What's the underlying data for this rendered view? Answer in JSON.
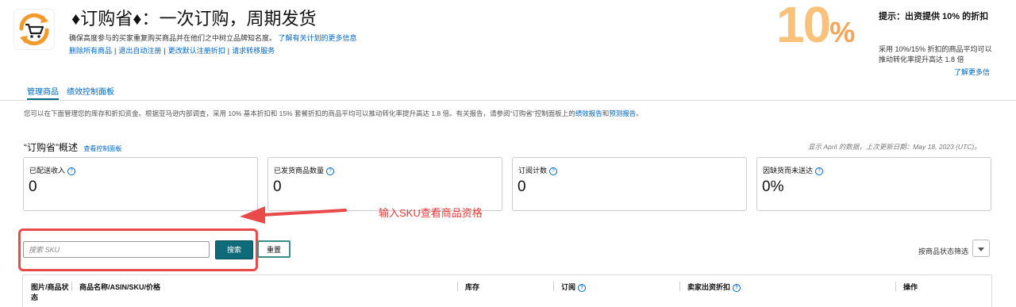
{
  "header": {
    "title": "♦订购省♦：一次订购，周期发货",
    "description": "确保高度参与的买家重复购买商品并在他们之中树立品牌知名度。",
    "learn_more": "了解有关计划的更多信息",
    "actions": [
      "删除所有商品",
      "退出自动注册",
      "更改默认注册折扣",
      "请求转移服务"
    ]
  },
  "promo": {
    "big_number": "10",
    "big_unit": "%",
    "tip_title": "提示：出资提供 10% 的折扣",
    "tip_body": "采用 10%/15% 折扣的商品平均可以推动转化率提升高达 1.8 倍",
    "learn_more": "了解更多信"
  },
  "tabs": [
    {
      "label": "管理商品",
      "active": true
    },
    {
      "label": "绩效控制面板",
      "active": false
    }
  ],
  "info_text": "您可以在下面管理您的库存和折扣资金。根据亚马逊内部调查，采用 10% 基本折扣和 15% 套餐折扣的商品平均可以推动转化率提升高达 1.8 倍。有关报告，请参阅“订购省”控制面板上的",
  "info_link1": "绩效报告",
  "info_and": "和",
  "info_link2": "预测报告",
  "info_end": "。",
  "overview": {
    "title": "“订购省”概述",
    "link": "查看控制面板",
    "shown": "显示 April 的数据，上次更新日期：May 18, 2023 (UTC)。"
  },
  "cards": [
    {
      "label": "已配送收入",
      "value": "0"
    },
    {
      "label": "已发货商品数量",
      "value": "0"
    },
    {
      "label": "订阅计数",
      "value": "0"
    },
    {
      "label": "因缺货而未送达",
      "value": "0%"
    }
  ],
  "annotation": "输入SKU查看商品资格",
  "search": {
    "placeholder": "搜索 SKU",
    "button": "搜索",
    "reset": "重置"
  },
  "filter": {
    "label": "按商品状态筛选",
    "icon": "chevron-down-icon"
  },
  "table": {
    "headers": [
      "图片/商品状态",
      "商品名称/ASIN/SKU/价格",
      "库存",
      "订阅",
      "卖家出资折扣",
      "操作"
    ]
  },
  "colors": {
    "accent": "#0066c0",
    "button": "#0f6b7a",
    "annotation": "#e33b3b",
    "promo": "#f9c27a"
  }
}
